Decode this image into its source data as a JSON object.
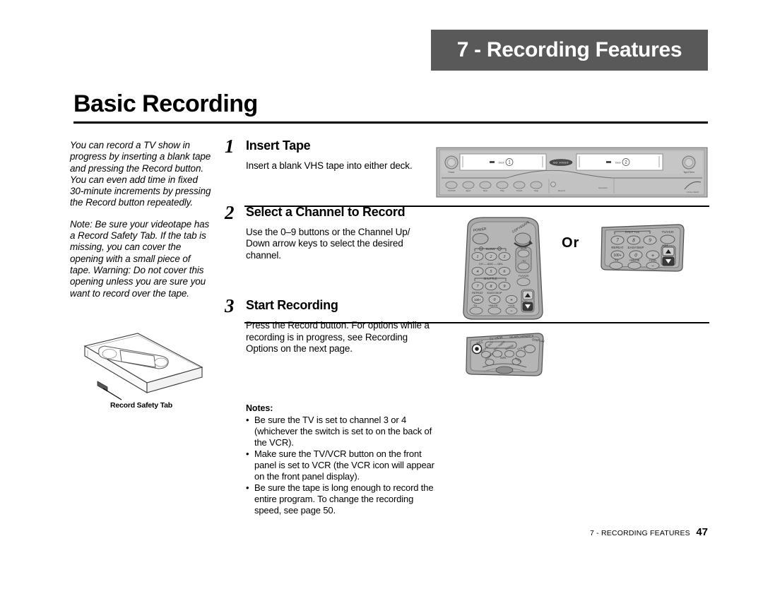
{
  "banner": {
    "label": "7 - Recording Features",
    "background": "#595959",
    "text_color": "#ffffff"
  },
  "page_title": "Basic Recording",
  "sidebar": {
    "paragraphs": [
      "You can record a TV show in progress by inserting a blank tape and pressing the Record button. You can even add time in fixed 30-minute increments by pressing the Record button repeatedly.",
      "Note: Be sure your videotape has a Record Safety Tab. If the tab is missing, you can cover the opening with a small piece of tape. Warning: Do not cover this opening unless you are sure you want to record over the tape."
    ]
  },
  "cassette_figure": {
    "caption": "Record Safety Tab"
  },
  "steps": [
    {
      "number": "1",
      "heading": "Insert Tape",
      "body": "Insert a blank VHS tape into either deck."
    },
    {
      "number": "2",
      "heading": "Select a Channel to Record",
      "body": "Use the 0–9 buttons or the Channel Up/ Down arrow keys to select the desired channel."
    },
    {
      "number": "3",
      "heading": "Start Recording",
      "body": "Press the Record button. For options while a recording is in progress, see Recording Options on the next page."
    }
  ],
  "notes": {
    "title": "Notes:",
    "bullet": "•",
    "items": [
      "Be sure the TV is set to channel 3 or 4 (whichever the switch is set to on the back of the VCR).",
      "Make sure the TV/VCR button on the front panel is set to VCR (the VCR icon will appear on the front panel display).",
      "Be sure the tape is long enough to record the entire program. To change the recording speed, see page 50."
    ]
  },
  "or_label": "Or",
  "vcr_panel": {
    "deck_one_label": "1",
    "deck_two_label": "2"
  },
  "remote_main": {
    "power_label": "POWER",
    "copy_save_label": "COPY&SAVE",
    "vcr_label": "VCR",
    "tv_label": "TV",
    "tv_vcr_label": "TV/VCR",
    "slow_label": "SLOW",
    "ch_label": "CH",
    "add_label": "ADD",
    "del_label": "DEL",
    "shuttle_label": "SHUTTLE",
    "repeat_label": "REPEAT",
    "easy_skip_label": "EASY/SKIP",
    "hundred_label": "100+",
    "tv_ch_label": "-TV",
    "mute_label": "+MUTE",
    "vol_label": "+VOL",
    "ch_updown_label": "+CH",
    "keys": [
      "1",
      "2",
      "3",
      "4",
      "5",
      "6",
      "7",
      "8",
      "9",
      "0"
    ]
  },
  "remote_small": {
    "keys": [
      "7",
      "8",
      "9",
      "0"
    ],
    "hundred_label": "100+",
    "tv_vcr_label": "TV/VCR",
    "shuttle_label": "SHUTTLE",
    "repeat_label": "REPEAT",
    "easy_skip_label": "EASY/SKIP",
    "tv_label": "-TV",
    "mute_label": "+MUTE",
    "vol_label": "+VOL",
    "ch_label": "+CH"
  },
  "remote_rec": {
    "rec_label": "REC",
    "tv_view_label": "TV VIEW",
    "search_index_label": "SEARCH/INDEX",
    "display_label": "DISPLAY"
  },
  "footer": {
    "chapter": "7 - RECORDING FEATURES",
    "page": "47"
  }
}
